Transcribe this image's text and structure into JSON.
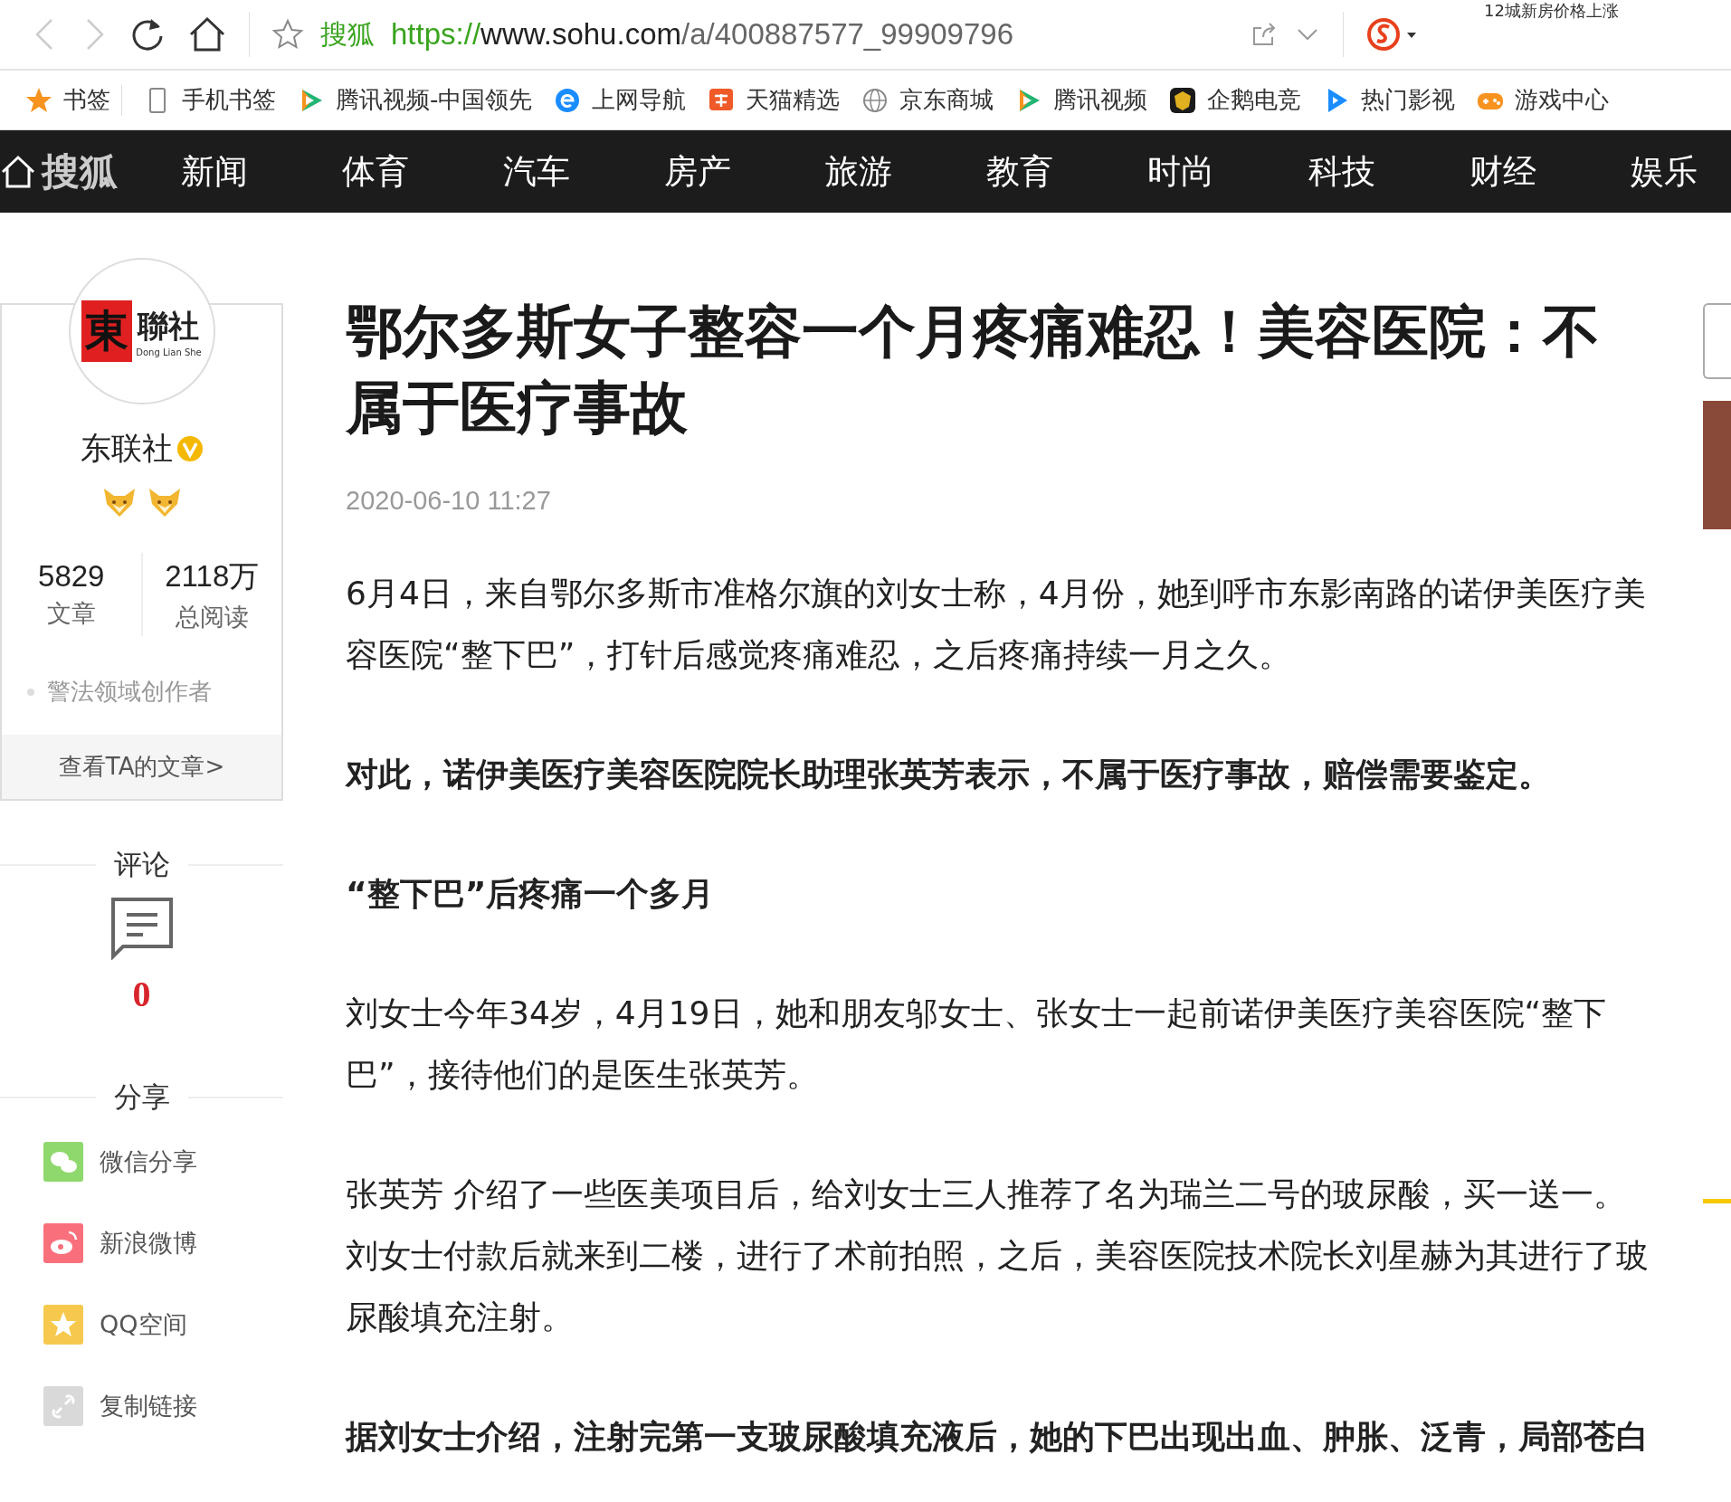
{
  "browser": {
    "site_name": "搜狐",
    "url_scheme": "https://",
    "url_host": "www.sohu.com",
    "url_path": "/a/400887577_99909796",
    "corner_text": "12城新房价格上涨"
  },
  "bookmarks": [
    {
      "label": "书签",
      "kind": "star"
    },
    {
      "label": "手机书签",
      "kind": "phone"
    },
    {
      "label": "腾讯视频-中国领先",
      "kind": "play"
    },
    {
      "label": "上网导航",
      "kind": "ie"
    },
    {
      "label": "天猫精选",
      "kind": "tmall"
    },
    {
      "label": "京东商城",
      "kind": "globe"
    },
    {
      "label": "腾讯视频",
      "kind": "play"
    },
    {
      "label": "企鹅电竞",
      "kind": "badge"
    },
    {
      "label": "热门影视",
      "kind": "blueplay"
    },
    {
      "label": "游戏中心",
      "kind": "gamepad"
    }
  ],
  "nav": {
    "logo": "搜狐",
    "items": [
      "新闻",
      "体育",
      "汽车",
      "房产",
      "旅游",
      "教育",
      "时尚",
      "科技",
      "财经",
      "娱乐"
    ]
  },
  "author": {
    "logo_mark": "東",
    "logo_text": "聯社",
    "logo_sub": "Dong Lian She",
    "name": "东联社",
    "verified": true,
    "badges": [
      {
        "kind": "fox"
      },
      {
        "kind": "fox"
      }
    ],
    "stats": [
      {
        "value": "5829",
        "label": "文章"
      },
      {
        "value": "2118万",
        "label": "总阅读"
      }
    ],
    "tag": "警法领域创作者",
    "more": "查看TA的文章>"
  },
  "comments": {
    "title": "评论",
    "count": "0"
  },
  "share": {
    "title": "分享",
    "items": [
      {
        "label": "微信分享",
        "kind": "wechat"
      },
      {
        "label": "新浪微博",
        "kind": "weibo"
      },
      {
        "label": "QQ空间",
        "kind": "qzone"
      },
      {
        "label": "复制链接",
        "kind": "link"
      }
    ]
  },
  "article": {
    "title": "鄂尔多斯女子整容一个月疼痛难忍！美容医院：不属于医疗事故",
    "date": "2020-06-10 11:27",
    "paragraphs": [
      {
        "kind": "text",
        "text": "6月4日，来自鄂尔多斯市准格尔旗的刘女士称，4月份，她到呼市东影南路的诺伊美医疗美容医院“整下巴”，打针后感觉疼痛难忍，之后疼痛持续一月之久。"
      },
      {
        "kind": "bold",
        "text": "对此，诺伊美医疗美容医院院长助理张英芳表示，不属于医疗事故，赔偿需要鉴定。"
      },
      {
        "kind": "heading",
        "text": "“整下巴”后疼痛一个多月"
      },
      {
        "kind": "text",
        "text": "刘女士今年34岁，4月19日，她和朋友邬女士、张女士一起前诺伊美医疗美容医院“整下巴”，接待他们的是医生张英芳。"
      },
      {
        "kind": "text",
        "text": "张英芳 介绍了一些医美项目后，给刘女士三人推荐了名为瑞兰二号的玻尿酸，买一送一。刘女士付款后就来到二楼，进行了术前拍照，之后，美容医院技术院长刘星赫为其进行了玻尿酸填充注射。"
      },
      {
        "kind": "bold",
        "text": "据刘女士介绍，注射完第一支玻尿酸填充液后，她的下巴出现出血、肿胀、泛青，局部苍白"
      }
    ]
  }
}
